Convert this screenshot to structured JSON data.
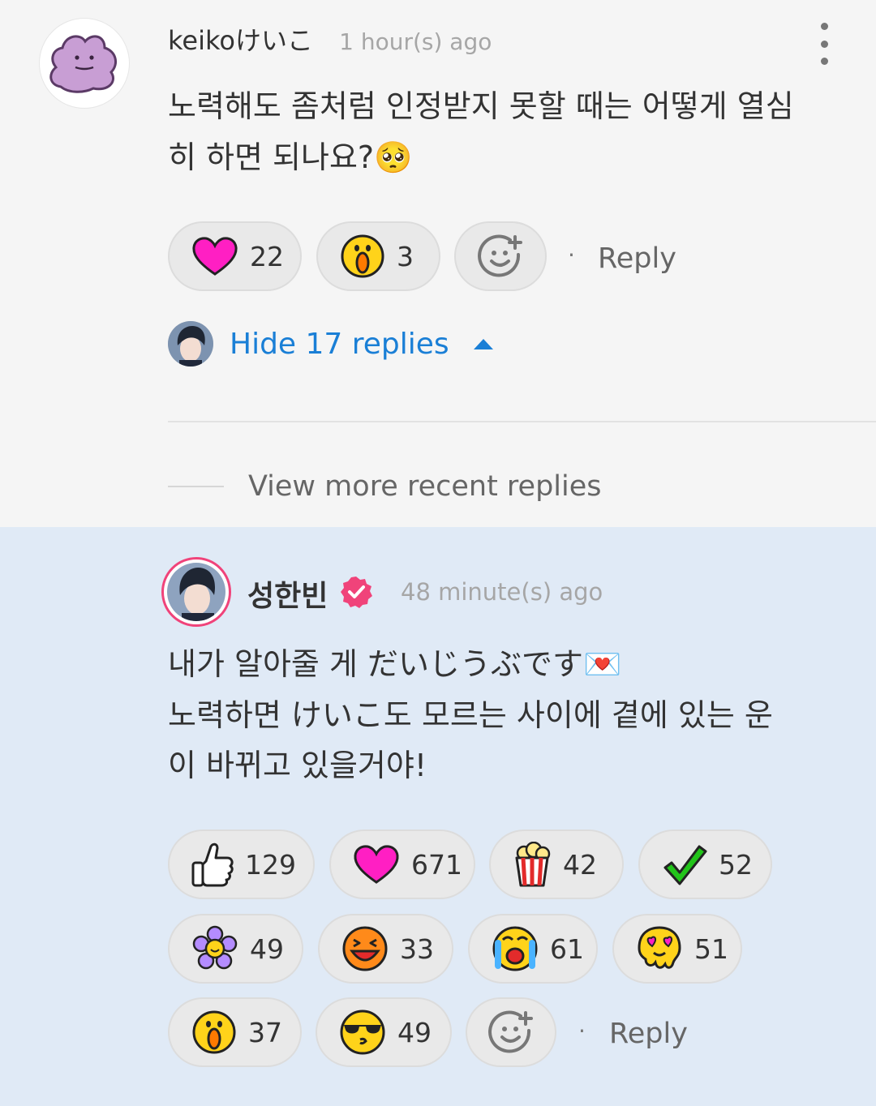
{
  "top_comment": {
    "username": "keikoけいこ",
    "time": "1 hour(s) ago",
    "text_line1": "노력해도 좀처럼 인정받지 못할 때는 어떻게 열심",
    "text_line2": "히 하면 되나요?",
    "text_emoji": "🥺",
    "reactions": [
      {
        "icon": "heart-icon",
        "count": "22"
      },
      {
        "icon": "surprised-face-icon",
        "count": "3"
      }
    ],
    "reply_label": "Reply"
  },
  "replies_toggle": {
    "label": "Hide 17 replies"
  },
  "view_more": {
    "label": "View more recent replies"
  },
  "reply_comment": {
    "author": "성한빈",
    "time": "48 minute(s) ago",
    "text_line1": "내가 알아줄 게 だいじうぶです",
    "text_line1_emoji": "💌",
    "text_line2": "노력하면 けいこ도 모르는 사이에 곁에 있는 운",
    "text_line3": "이 바뀌고 있을거야!",
    "reactions": [
      {
        "icon": "thumbs-up-icon",
        "count": "129"
      },
      {
        "icon": "heart-icon",
        "count": "671"
      },
      {
        "icon": "popcorn-icon",
        "count": "42"
      },
      {
        "icon": "checkmark-icon",
        "count": "52"
      },
      {
        "icon": "flower-icon",
        "count": "49"
      },
      {
        "icon": "laughing-face-icon",
        "count": "33"
      },
      {
        "icon": "crying-face-icon",
        "count": "61"
      },
      {
        "icon": "heart-eyes-melting-face-icon",
        "count": "51"
      },
      {
        "icon": "surprised-face-icon",
        "count": "37"
      },
      {
        "icon": "sunglasses-face-icon",
        "count": "49"
      }
    ],
    "reply_label": "Reply"
  },
  "colors": {
    "accent_blue": "#1a7fd6",
    "verified_pink": "#f0437a",
    "reply_bg": "#e0eaf6"
  }
}
